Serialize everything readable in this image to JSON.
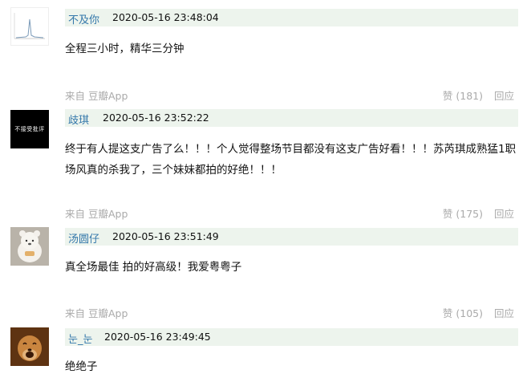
{
  "comments": [
    {
      "avatar": "chart-avatar",
      "avatar_text": "",
      "username": "不及你",
      "time": "2020-05-16 23:48:04",
      "text": "全程三小时，精华三分钟",
      "source": "来自 豆瓣App",
      "like_label": "赞",
      "like_count": "(181)",
      "reply_label": "回应"
    },
    {
      "avatar": "text-avatar",
      "avatar_text": "不接受批评",
      "username": "歧琪",
      "time": "2020-05-16 23:52:22",
      "text": "终于有人提这支广告了么！！！个人觉得整场节目都没有这支广告好看！！！苏芮琪成熟猛1职场风真的杀我了，三个妹妹都拍的好绝！！！",
      "source": "来自 豆瓣App",
      "like_label": "赞",
      "like_count": "(175)",
      "reply_label": "回应"
    },
    {
      "avatar": "bear-avatar",
      "avatar_text": "",
      "username": "汤圆仔",
      "time": "2020-05-16 23:51:49",
      "text": "真全场最佳 拍的好高级！我爱粤粤子",
      "source": "来自 豆瓣App",
      "like_label": "赞",
      "like_count": "(105)",
      "reply_label": "回应"
    },
    {
      "avatar": "dog-avatar",
      "avatar_text": "",
      "username": "눈_눈",
      "time": "2020-05-16 23:49:45",
      "text": "绝绝子"
    }
  ]
}
